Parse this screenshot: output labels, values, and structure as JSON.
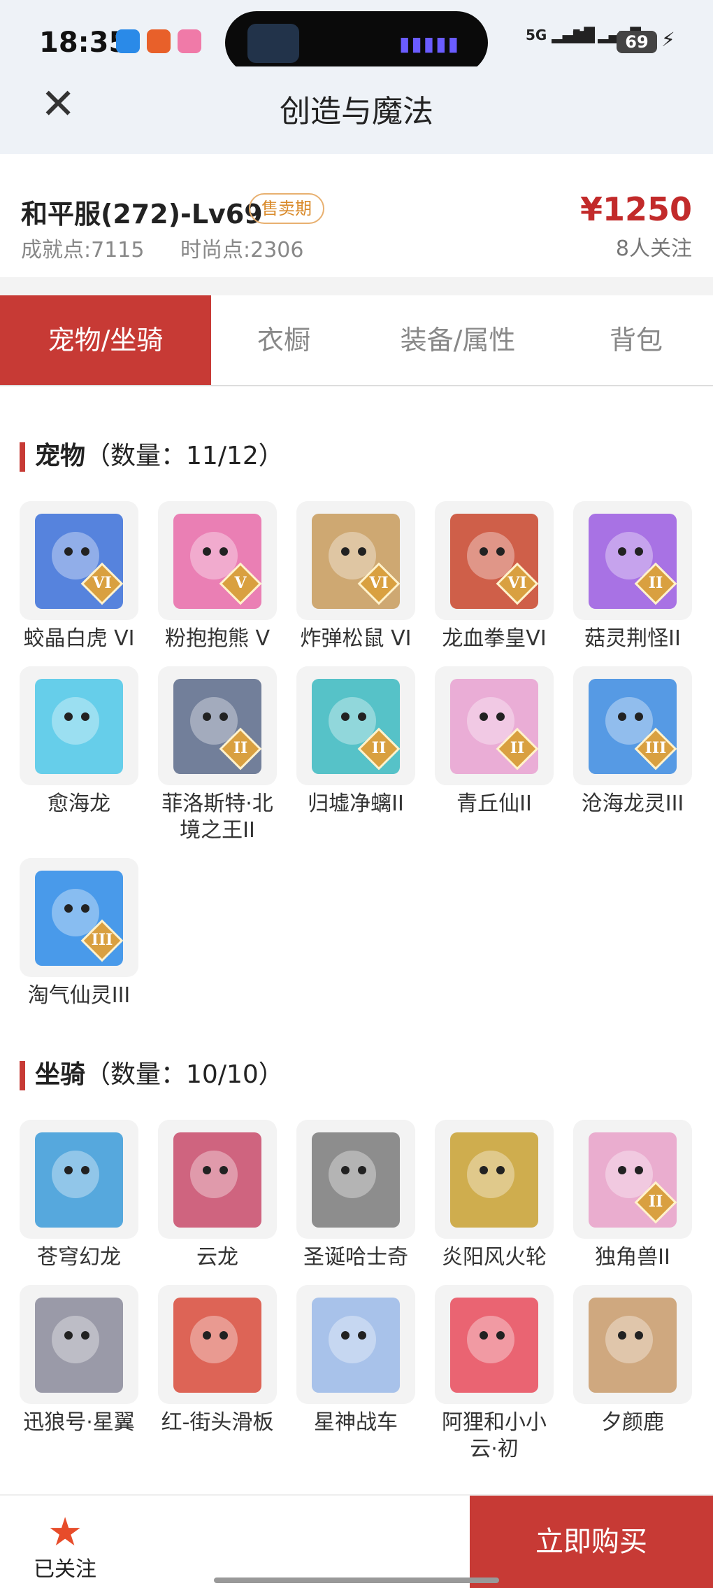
{
  "status": {
    "time": "18:35",
    "signal1": "5G",
    "signal2": "5G",
    "battery": "69"
  },
  "header": {
    "title": "创造与魔法"
  },
  "listing": {
    "name": "和平服(272)-Lv69",
    "badge": "售卖期",
    "price": "¥1250",
    "achievement": "成就点:7115",
    "fashion": "时尚点:2306",
    "followers": "8人关注"
  },
  "tabs": [
    "宠物/坐骑",
    "衣橱",
    "装备/属性",
    "背包"
  ],
  "pets": {
    "title": "宠物",
    "count": "（数量：11/12）",
    "items": [
      {
        "name": "蛟晶白虎 VI",
        "rank": "VI",
        "color": "#3a6fd8"
      },
      {
        "name": "粉抱抱熊 V",
        "rank": "V",
        "color": "#e86aa8"
      },
      {
        "name": "炸弹松鼠 VI",
        "rank": "VI",
        "color": "#c79a5a"
      },
      {
        "name": "龙血拳皇VI",
        "rank": "VI",
        "color": "#c8442a"
      },
      {
        "name": "菇灵荆怪II",
        "rank": "II",
        "color": "#9a5ae0"
      },
      {
        "name": "愈海龙",
        "rank": "",
        "color": "#4cc7e8"
      },
      {
        "name": "菲洛斯特·北境之王II",
        "rank": "II",
        "color": "#5a6a8a"
      },
      {
        "name": "归墟净螭II",
        "rank": "II",
        "color": "#3ab8c0"
      },
      {
        "name": "青丘仙II",
        "rank": "II",
        "color": "#e8a0d0"
      },
      {
        "name": "沧海龙灵III",
        "rank": "III",
        "color": "#3a8ae0"
      },
      {
        "name": "淘气仙灵III",
        "rank": "III",
        "color": "#2a8ae8"
      }
    ]
  },
  "mounts": {
    "title": "坐骑",
    "count": "（数量：10/10）",
    "items": [
      {
        "name": "苍穹幻龙",
        "rank": "",
        "color": "#3a9ad8"
      },
      {
        "name": "云龙",
        "rank": "",
        "color": "#c84a6a"
      },
      {
        "name": "圣诞哈士奇",
        "rank": "",
        "color": "#7a7a7a"
      },
      {
        "name": "炎阳风火轮",
        "rank": "",
        "color": "#c8a030"
      },
      {
        "name": "独角兽II",
        "rank": "II",
        "color": "#e8a0c8"
      },
      {
        "name": "迅狼号·星翼",
        "rank": "",
        "color": "#8a8a9a"
      },
      {
        "name": "红-街头滑板",
        "rank": "",
        "color": "#d84a3a"
      },
      {
        "name": "星神战车",
        "rank": "",
        "color": "#9ab8e8"
      },
      {
        "name": "阿狸和小小云·初",
        "rank": "",
        "color": "#e84a5a"
      },
      {
        "name": "夕颜鹿",
        "rank": "",
        "color": "#c89a6a"
      }
    ]
  },
  "footer": {
    "follow_label": "已关注",
    "buy_label": "立即购买"
  }
}
